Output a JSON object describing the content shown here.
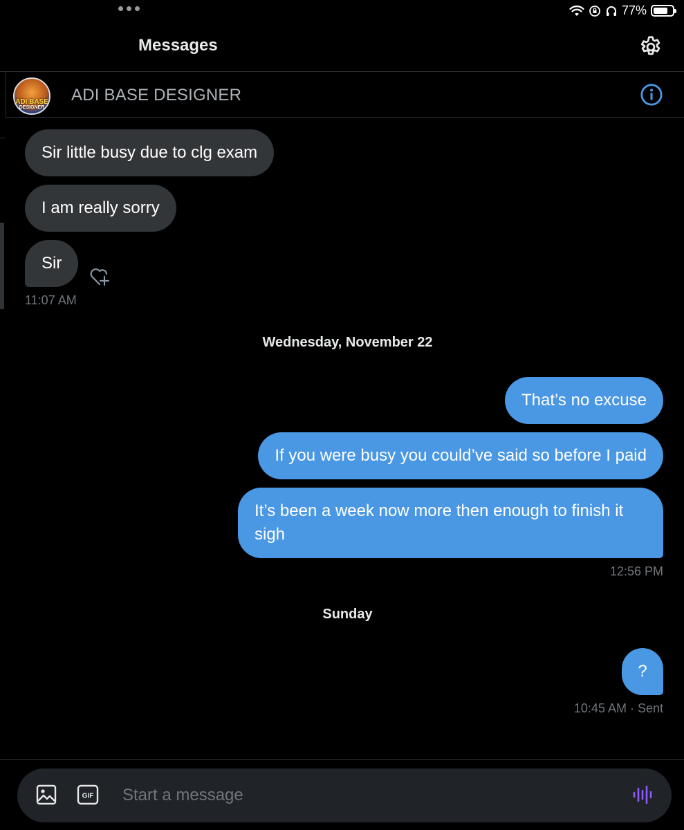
{
  "status_bar": {
    "battery": "77%",
    "battery_level": 0.77
  },
  "header": {
    "title": "Messages"
  },
  "conversation": {
    "name": "ADI BASE DESIGNER",
    "avatar_text_line1": "ADI BASE",
    "avatar_text_line2": "DESIGNER"
  },
  "messages": {
    "in1": "Sir little busy due to clg exam",
    "in2": "I am really sorry",
    "in3": "Sir",
    "in_time": "11:07 AM",
    "date1": "Wednesday, November 22",
    "out1": "That’s no excuse",
    "out2": "If you were busy you could’ve said so before I paid",
    "out3": "It’s been a week now more then enough to finish it sigh",
    "out_time": "12:56 PM",
    "date2": "Sunday",
    "out4": "?",
    "last_time": "10:45 AM",
    "last_status": " · Sent"
  },
  "composer": {
    "placeholder": "Start a message",
    "gif_label": "GIF"
  },
  "colors": {
    "accent": "#4a97e4",
    "incoming": "#333639",
    "background": "#000000",
    "voice_icon": "#8b5cf6"
  },
  "icons": [
    "wifi-icon",
    "rotation-lock-icon",
    "headphones-icon",
    "battery-icon",
    "gear-icon",
    "info-icon",
    "heart-plus-icon",
    "image-icon",
    "gif-icon",
    "voice-icon"
  ]
}
